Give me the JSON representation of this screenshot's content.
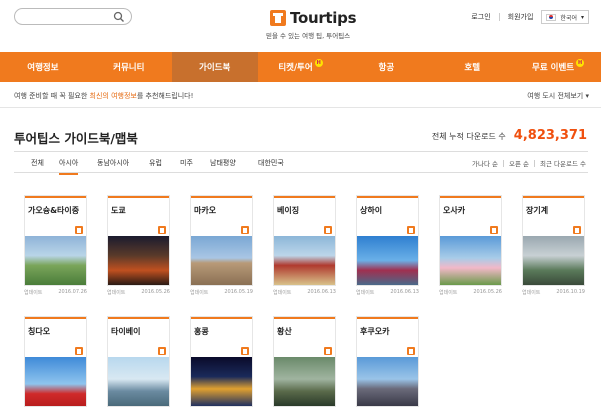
{
  "search": {
    "placeholder": ""
  },
  "logo": {
    "name": "Tourtips",
    "tagline": "믿을 수 있는 여행 팁, 투어팁스"
  },
  "toplinks": {
    "login": "로그인",
    "join": "회원가입",
    "language": "한국어"
  },
  "nav": [
    {
      "label": "여행정보",
      "active": false,
      "badge": ""
    },
    {
      "label": "커뮤니티",
      "active": false,
      "badge": ""
    },
    {
      "label": "가이드북",
      "active": true,
      "badge": ""
    },
    {
      "label": "티켓/투어",
      "active": false,
      "badge": "H"
    },
    {
      "label": "항공",
      "active": false,
      "badge": ""
    },
    {
      "label": "호텔",
      "active": false,
      "badge": ""
    },
    {
      "label": "무료 이벤트",
      "active": false,
      "badge": "H"
    }
  ],
  "notice": {
    "pre": "여행 준비할 때 꼭 필요한 ",
    "highlight": "최신의 여행정보",
    "post": "를 추천해드립니다!",
    "all_cities": "여행 도시 전체보기"
  },
  "page": {
    "title": "투어팁스 가이드북/맵북",
    "download_label": "전체 누적 다운로드 수",
    "download_count": "4,823,371"
  },
  "tabs": [
    "전체",
    "아시아",
    "동남아시아",
    "유럽",
    "미주",
    "남태평양",
    "대한민국"
  ],
  "active_tab": 1,
  "sorts": [
    "가나다 순",
    "오픈 순",
    "최근 다운로드 수"
  ],
  "cards": [
    {
      "city": "가오슝&타이중",
      "update_label": "업데이트",
      "date": "2016.07.26"
    },
    {
      "city": "도쿄",
      "update_label": "업데이트",
      "date": "2016.05.26"
    },
    {
      "city": "마카오",
      "update_label": "업데이트",
      "date": "2016.05.19"
    },
    {
      "city": "베이징",
      "update_label": "업데이트",
      "date": "2016.06.13"
    },
    {
      "city": "상하이",
      "update_label": "업데이트",
      "date": "2016.06.13"
    },
    {
      "city": "오사카",
      "update_label": "업데이트",
      "date": "2016.05.26"
    },
    {
      "city": "장기계",
      "update_label": "업데이트",
      "date": "2016.10.19"
    },
    {
      "city": "칭다오",
      "update_label": "",
      "date": ""
    },
    {
      "city": "타이베이",
      "update_label": "",
      "date": ""
    },
    {
      "city": "홍콩",
      "update_label": "",
      "date": ""
    },
    {
      "city": "황산",
      "update_label": "",
      "date": ""
    },
    {
      "city": "후쿠오카",
      "update_label": "",
      "date": ""
    }
  ],
  "colors": {
    "accent": "#f07a1e",
    "nav_active": "#c8702d",
    "count": "#f0500f"
  }
}
